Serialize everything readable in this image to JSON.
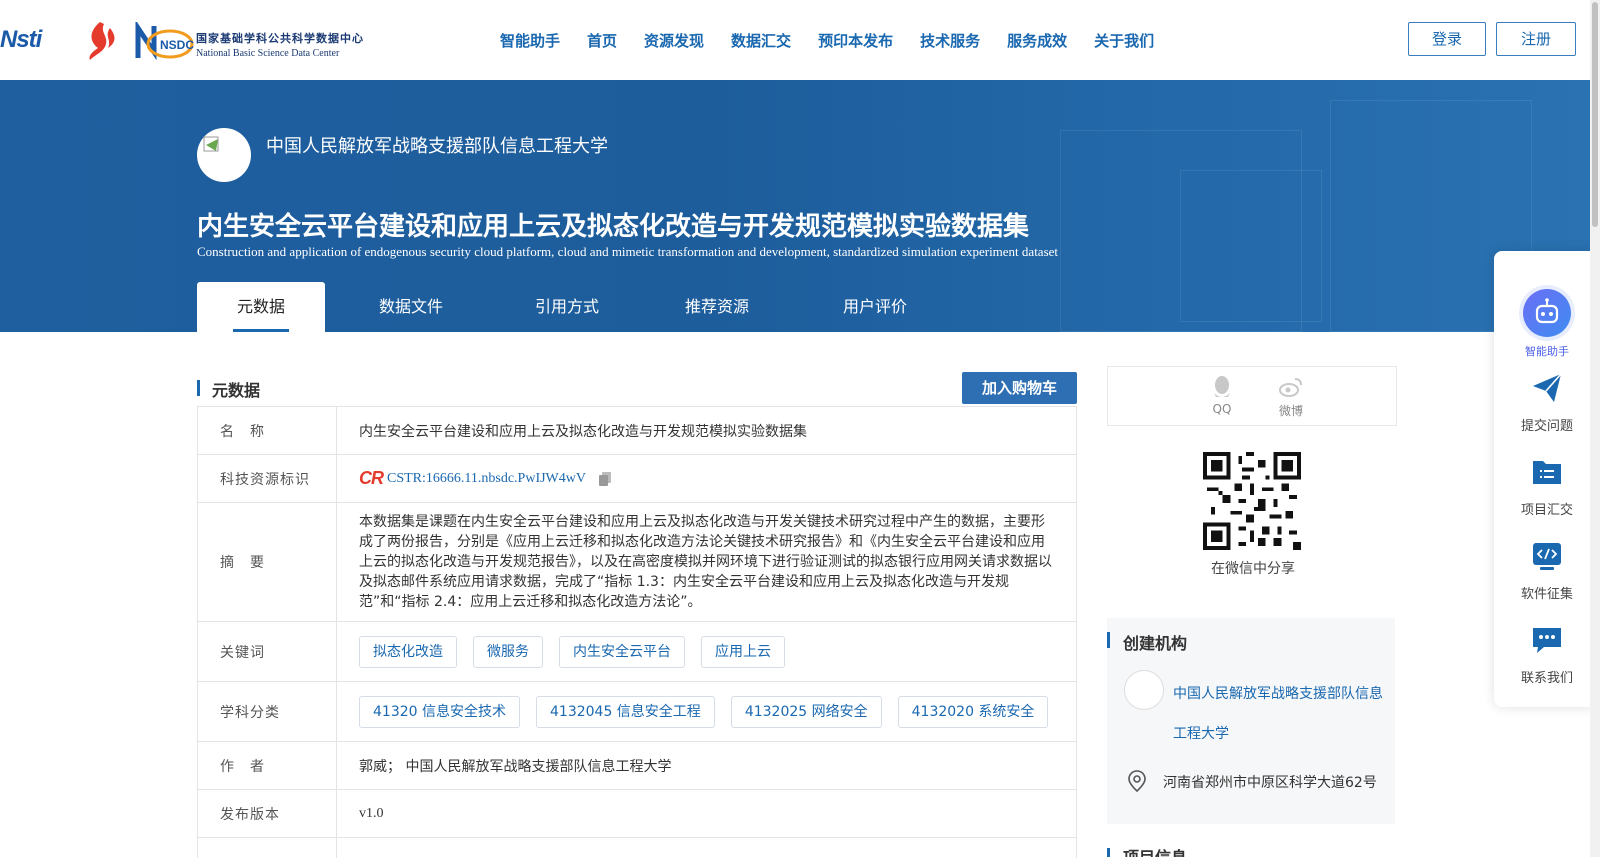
{
  "header": {
    "logos": {
      "cstr_text": "Nsti",
      "nsdc_badge": "NSDC",
      "nsdc_cn": "国家基础学科公共科学数据中心",
      "nsdc_en": "National Basic Science Data Center"
    },
    "nav": [
      "智能助手",
      "首页",
      "资源发现",
      "数据汇交",
      "预印本发布",
      "技术服务",
      "服务成效",
      "关于我们"
    ],
    "login_label": "登录",
    "register_label": "注册"
  },
  "banner": {
    "org_name": "中国人民解放军战略支援部队信息工程大学",
    "title": "内生安全云平台建设和应用上云及拟态化改造与开发规范模拟实验数据集",
    "subtitle": "Construction and application of endogenous security cloud platform, cloud and mimetic transformation and development, standardized simulation experiment dataset",
    "tabs": [
      "元数据",
      "数据文件",
      "引用方式",
      "推荐资源",
      "用户评价"
    ],
    "active_tab": "元数据"
  },
  "metadata": {
    "section_title": "元数据",
    "cart_label": "加入购物车",
    "rows": {
      "name": {
        "label": "名　称",
        "value": "内生安全云平台建设和应用上云及拟态化改造与开发规范模拟实验数据集"
      },
      "identifier": {
        "label": "科技资源标识",
        "logo": "CR",
        "value": "CSTR:16666.11.nbsdc.PwIJW4wV"
      },
      "abstract": {
        "label": "摘　要",
        "value": "本数据集是课题在内生安全云平台建设和应用上云及拟态化改造与开发关键技术研究过程中产生的数据，主要形成了两份报告，分别是《应用上云迁移和拟态化改造方法论关键技术研究报告》和《内生安全云平台建设和应用上云的拟态化改造与开发规范报告》，以及在高密度模拟并网环境下进行验证测试的拟态银行应用网关请求数据以及拟态邮件系统应用请求数据，完成了“指标 1.3：内生安全云平台建设和应用上云及拟态化改造与开发规范”和“指标 2.4：应用上云迁移和拟态化改造方法论”。"
      },
      "keywords": {
        "label": "关键词",
        "values": [
          "拟态化改造",
          "微服务",
          "内生安全云平台",
          "应用上云"
        ]
      },
      "subjects": {
        "label": "学科分类",
        "values": [
          "41320 信息安全技术",
          "4132045 信息安全工程",
          "4132025 网络安全",
          "4132020 系统安全"
        ]
      },
      "authors": {
        "label": "作　者",
        "value": "郭威； 中国人民解放军战略支援部队信息工程大学"
      },
      "version": {
        "label": "发布版本",
        "value": "v1.0"
      }
    }
  },
  "sidebar": {
    "share": {
      "qq": "QQ",
      "weibo": "微博",
      "wechat_caption": "在微信中分享"
    },
    "creator": {
      "title": "创建机构",
      "name": "中国人民解放军战略支援部队信息工程大学",
      "address": "河南省郑州市中原区科学大道62号"
    },
    "project_title": "项目信息"
  },
  "float_panel": {
    "items": [
      "智能助手",
      "提交问题",
      "项目汇交",
      "软件征集",
      "联系我们"
    ]
  },
  "colors": {
    "brand": "#1a68b0",
    "banner": "#1f5f9f",
    "cart": "#2e6fb4",
    "ai": "#4b5fe8"
  }
}
